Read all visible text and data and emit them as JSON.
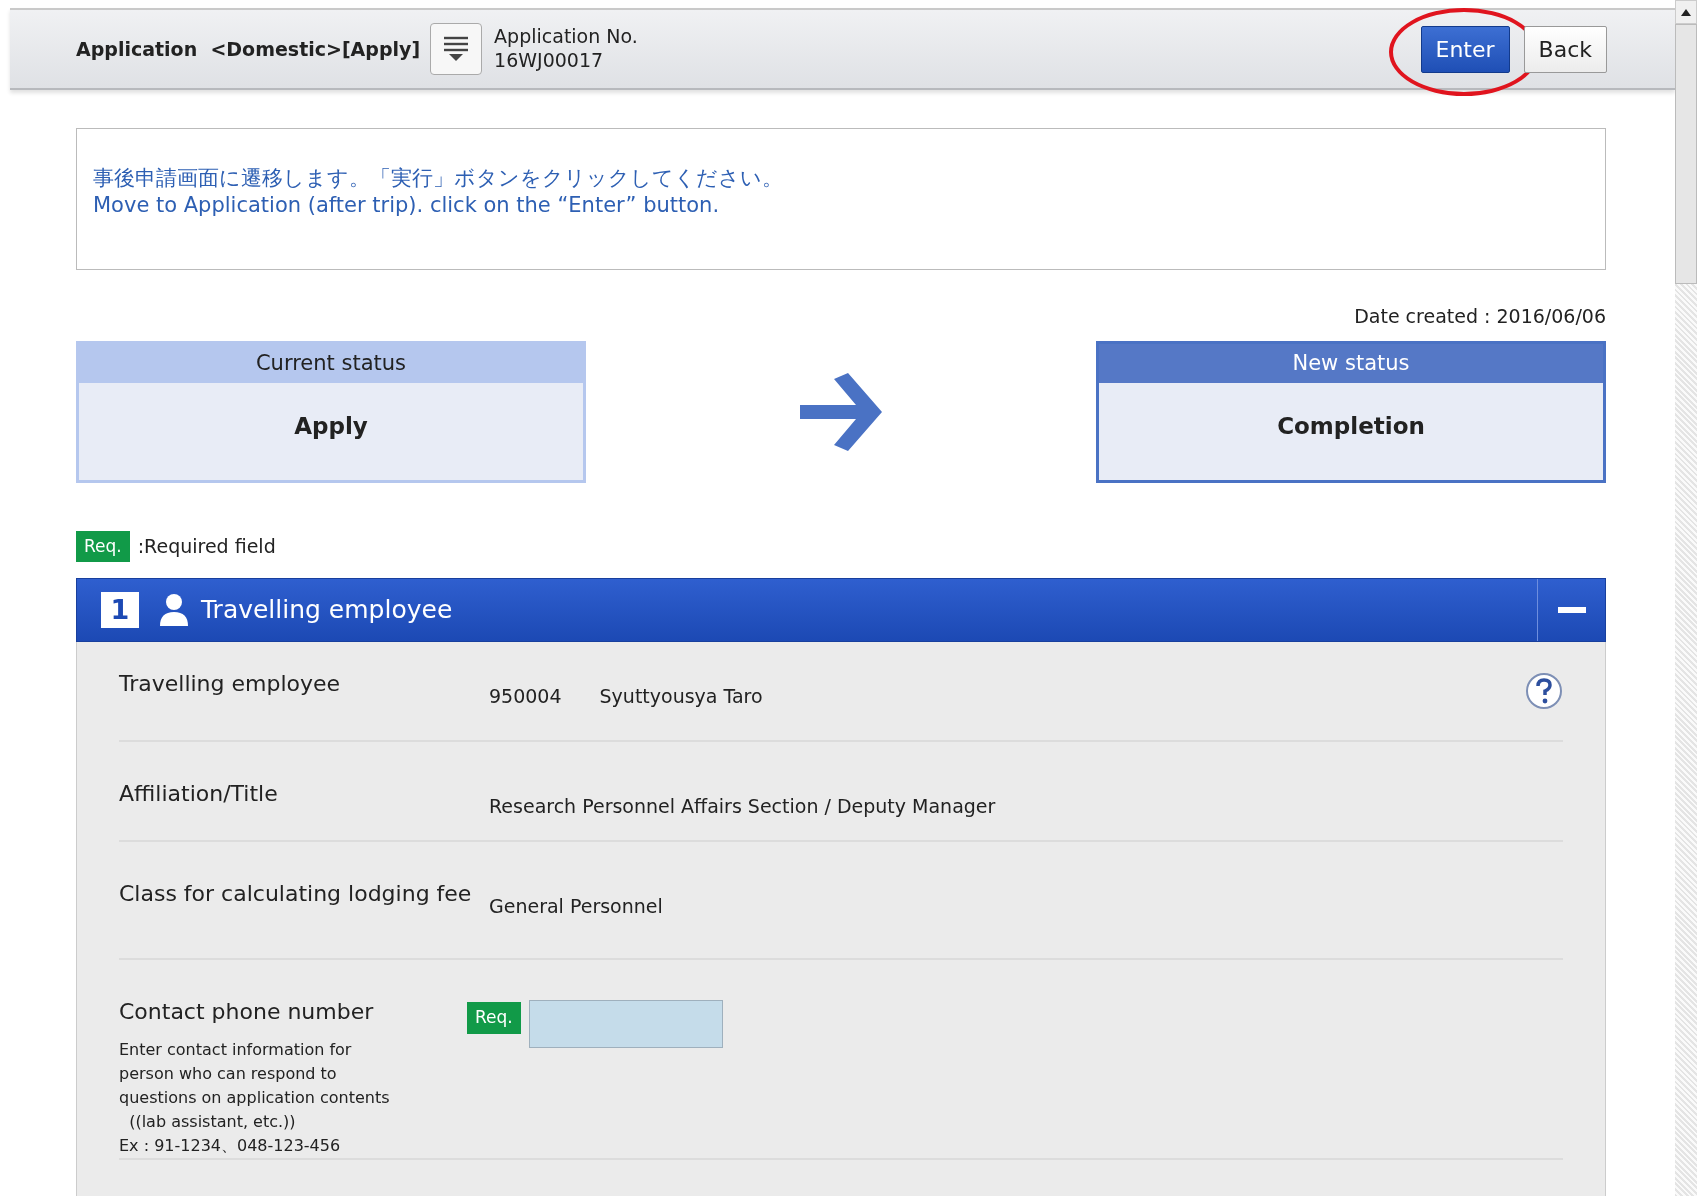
{
  "header": {
    "title": "Application",
    "category": "<Domestic>[Apply]",
    "number_label": "Application No.",
    "number": "16WJ00017"
  },
  "buttons": [
    {
      "label": "Enter",
      "kind": "primary",
      "highlighted": true
    },
    {
      "label": "Back",
      "kind": "secondary",
      "highlighted": false
    }
  ],
  "message": [
    "事後申請画面に遷移します。「実行」ボタンをクリックしてください。",
    "Move to Application (after trip). click on the “Enter” button."
  ],
  "date_created": "Date created : 2016/06/06",
  "statuses": [
    {
      "heading": "Current status",
      "value": "Apply",
      "kind": "current"
    },
    {
      "heading": "New status",
      "value": "Completion",
      "kind": "new"
    }
  ],
  "legend": {
    "badge": "Req.",
    "text": ":Required field"
  },
  "section": {
    "number": "1",
    "title": "Travelling employee",
    "expanded": true,
    "rows": [
      {
        "kind": "text",
        "label": "Travelling employee",
        "values": [
          "950004",
          "Syuttyousya Taro"
        ],
        "help": true
      },
      {
        "kind": "text",
        "label": "Affiliation/Title",
        "values": [
          "Research Personnel Affairs Section / Deputy Manager"
        ],
        "help": false
      },
      {
        "kind": "text",
        "label": "Class for calculating lodging fee",
        "values": [
          "General Personnel"
        ],
        "help": false
      },
      {
        "kind": "input",
        "label": "Contact phone number",
        "badge": "Req.",
        "help": false,
        "note": [
          "Enter contact information for",
          "person who can respond to",
          "questions on application contents",
          "  ((lab assistant, etc.))",
          "Ex : 91-1234、048-123-456"
        ]
      }
    ]
  }
}
